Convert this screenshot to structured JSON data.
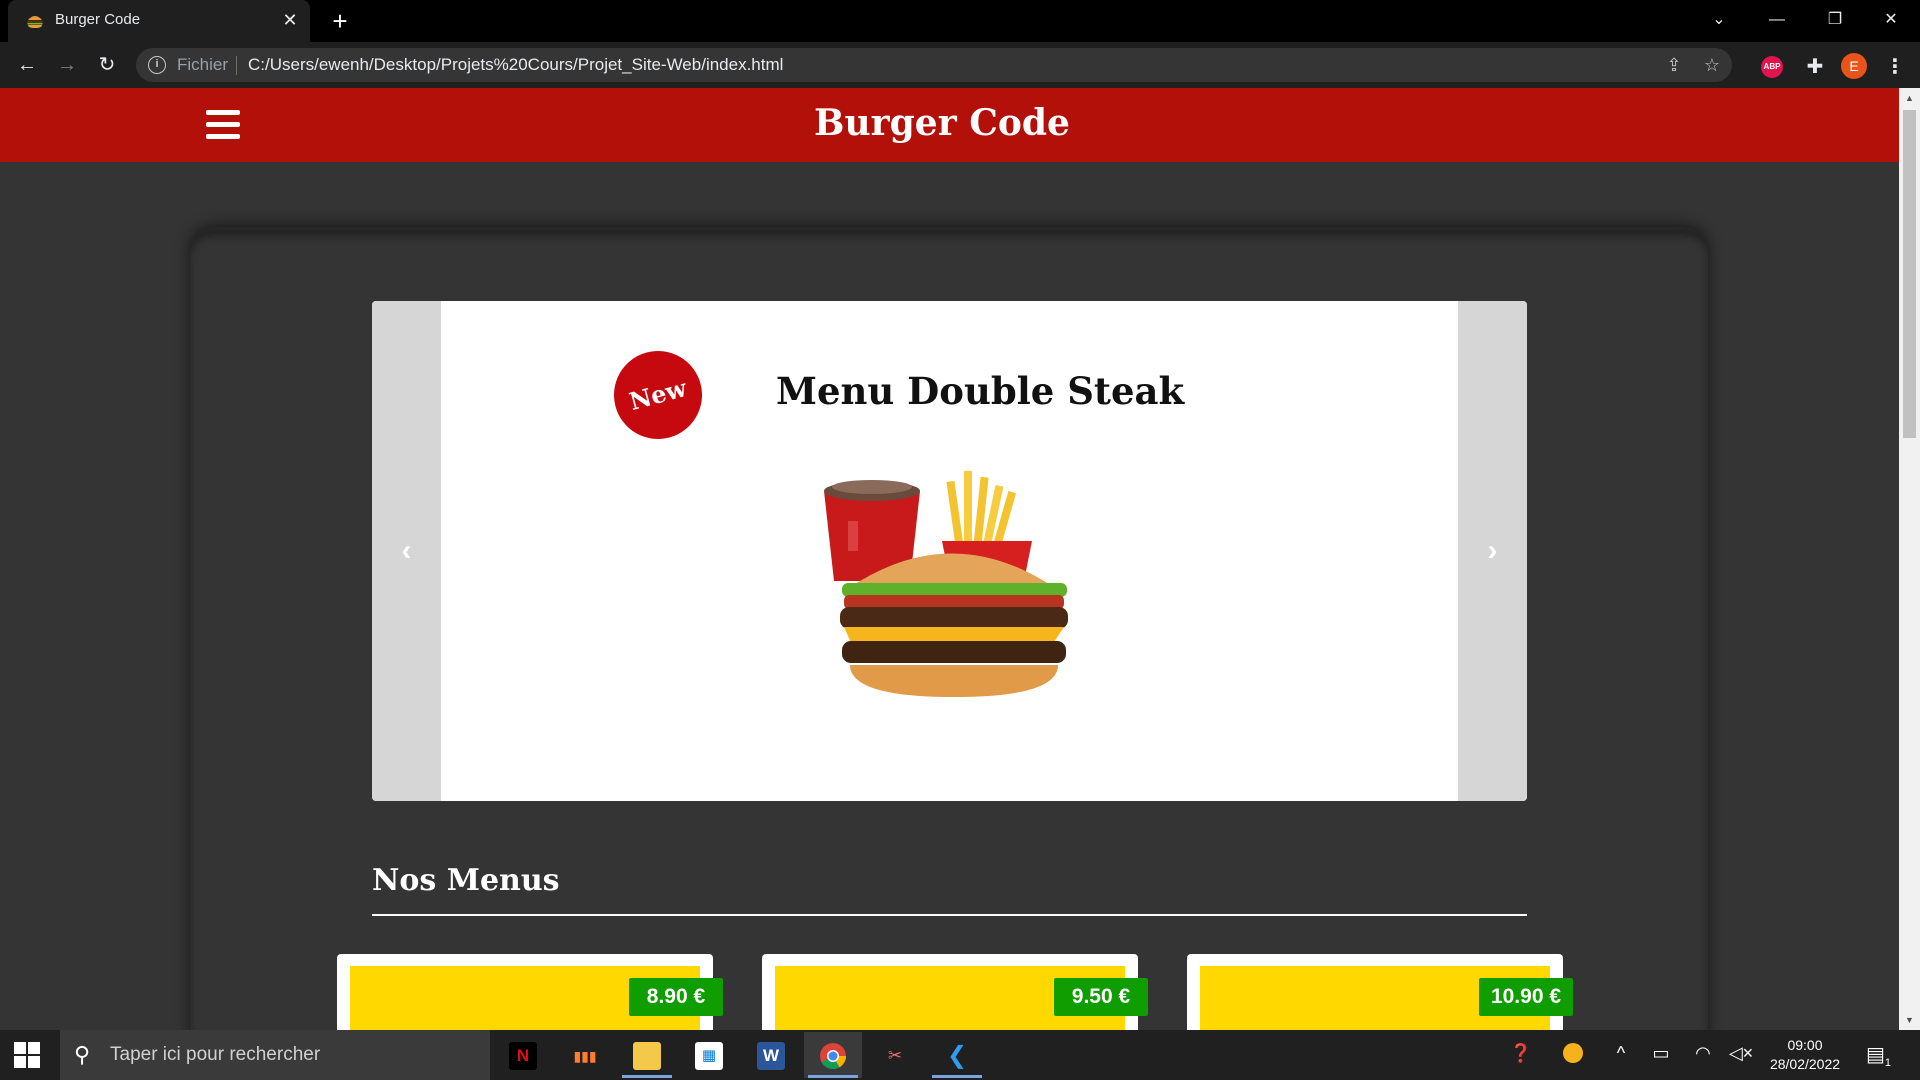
{
  "browser": {
    "tab_title": "Burger Code",
    "tab_close": "✕",
    "new_tab": "+",
    "url_scheme": "Fichier",
    "url": "C:/Users/ewenh/Desktop/Projets%20Cours/Projet_Site-Web/index.html",
    "profile_initial": "E",
    "abp_label": "ABP"
  },
  "site": {
    "title": "Burger Code",
    "carousel": {
      "badge": "New",
      "slide_title": "Menu Double Steak",
      "prev": "‹",
      "next": "›"
    },
    "section_title": "Nos Menus",
    "cards": [
      {
        "price": "8.90 €"
      },
      {
        "price": "9.50 €"
      },
      {
        "price": "10.90 €"
      }
    ],
    "colors": {
      "brand_red": "#b21008",
      "price_green": "#0f9d00",
      "card_yellow": "#ffd800"
    }
  },
  "taskbar": {
    "search_placeholder": "Taper ici pour rechercher",
    "time": "09:00",
    "date": "28/02/2022",
    "notif_count": "1"
  }
}
